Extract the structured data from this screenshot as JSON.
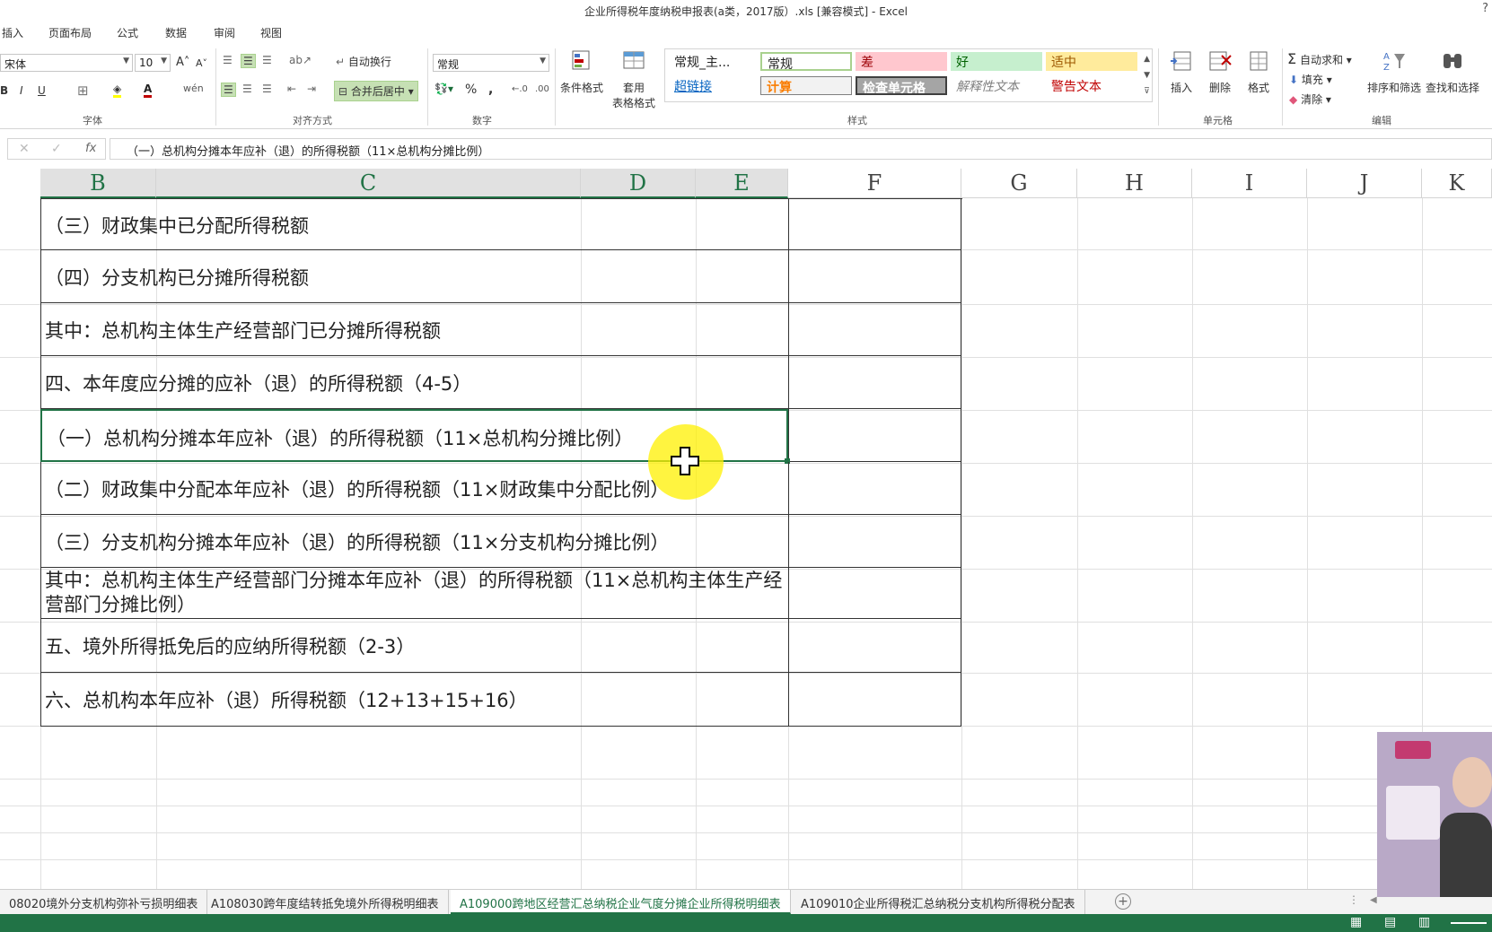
{
  "window": {
    "title": "企业所得税年度纳税申报表(a类，2017版）.xls  [兼容模式] - Excel",
    "help": "?"
  },
  "tabs": [
    "插入",
    "页面布局",
    "公式",
    "数据",
    "审阅",
    "视图"
  ],
  "ribbon": {
    "font_name": "宋体",
    "font_size": "10",
    "font_group": "字体",
    "align_group": "对齐方式",
    "wrap_text": "自动换行",
    "merge_center": "合并后居中",
    "number_format": "常规",
    "number_group": "数字",
    "cond_format": "条件格式",
    "table_format": [
      "套用",
      "表格格式"
    ],
    "styles": {
      "normal_main": "常规_主...",
      "normal": "常规",
      "bad": "差",
      "good": "好",
      "neutral": "适中",
      "hyperlink": "超链接",
      "calc": "计算",
      "check_cell": "检查单元格",
      "explanatory": "解释性文本",
      "warning": "警告文本"
    },
    "styles_group": "样式",
    "insert": "插入",
    "delete": "删除",
    "format": "格式",
    "cells_group": "单元格",
    "autosum": "自动求和",
    "fill": "填充",
    "clear": "清除",
    "sort_filter": "排序和筛选",
    "find_select": "查找和选择",
    "edit_group": "编辑",
    "colors": {
      "bad_bg": "#ffc7ce",
      "bad_fg": "#9c0006",
      "good_bg": "#c6efce",
      "good_fg": "#006100",
      "neutral_bg": "#ffeb9c",
      "neutral_fg": "#9c5700"
    }
  },
  "formula_bar": {
    "content": "（一）总机构分摊本年应补（退）的所得税额（11×总机构分摊比例）"
  },
  "columns": [
    "B",
    "C",
    "D",
    "E",
    "F",
    "G",
    "H",
    "I",
    "J",
    "K"
  ],
  "rows": [
    "（三）财政集中已分配所得税额",
    "（四）分支机构已分摊所得税额",
    "其中：总机构主体生产经营部门已分摊所得税额",
    "四、本年度应分摊的应补（退）的所得税额（4-5）",
    "（一）总机构分摊本年应补（退）的所得税额（11×总机构分摊比例）",
    "（二）财政集中分配本年应补（退）的所得税额（11×财政集中分配比例）",
    "（三）分支机构分摊本年应补（退）的所得税额（11×分支机构分摊比例）",
    "其中：总机构主体生产经营部门分摊本年应补（退）的所得税额（11×总机构主体生产经营部门分摊比例）",
    "五、境外所得抵免后的应纳所得税额（2-3）",
    "六、总机构本年应补（退）所得税额（12+13+15+16）"
  ],
  "sheet_tabs": [
    "08020境外分支机构弥补亏损明细表",
    "A108030跨年度结转抵免境外所得税明细表",
    "A109000跨地区经营汇总纳税企业气度分摊企业所得税明细表",
    "A109010企业所得税汇总纳税分支机构所得税分配表"
  ]
}
